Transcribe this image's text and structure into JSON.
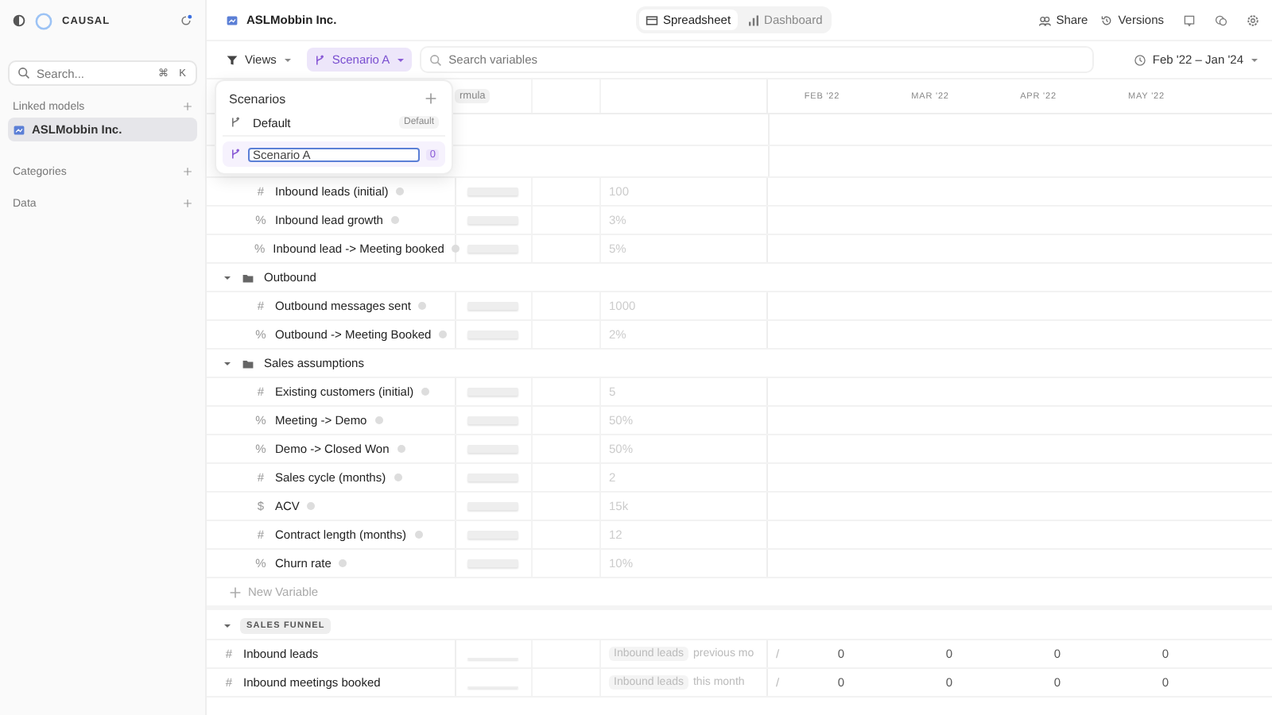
{
  "sidebar": {
    "brand": "CAUSAL",
    "search": {
      "placeholder": "Search...",
      "keys": [
        "⌘",
        "K"
      ]
    },
    "sections": [
      {
        "title": "Linked models",
        "items": [
          {
            "label": "ASLMobbin Inc.",
            "selected": true
          }
        ]
      },
      {
        "title": "Categories"
      },
      {
        "title": "Data"
      }
    ]
  },
  "topbar": {
    "model": "ASLMobbin Inc.",
    "views": [
      {
        "label": "Spreadsheet",
        "selected": true,
        "kind": "table"
      },
      {
        "label": "Dashboard",
        "selected": false,
        "kind": "chart"
      }
    ],
    "actions": [
      "Share",
      "Versions"
    ]
  },
  "toolbar": {
    "views": "Views",
    "scenario": "Scenario A",
    "search": {
      "placeholder": "Search variables"
    },
    "date_range": "Feb '22 – Jan '24"
  },
  "header": {
    "column_2": "rmula",
    "months": [
      "FEB '22",
      "MAR '22",
      "APR '22",
      "MAY '22"
    ]
  },
  "scenarios_menu": {
    "title": "Scenarios",
    "items": [
      {
        "kind": "item",
        "label": "Default",
        "badge": "Default"
      },
      {
        "kind": "editing",
        "value": "Scenario A",
        "count": "0"
      }
    ]
  },
  "rows": [
    {
      "kind": "variable",
      "icon": "#",
      "name": "Inbound leads (initial)",
      "value": "100"
    },
    {
      "kind": "variable",
      "icon": "%",
      "name": "Inbound lead growth",
      "value": "3%"
    },
    {
      "kind": "variable",
      "icon": "%",
      "name": "Inbound lead -> Meeting booked",
      "value": "5%"
    },
    {
      "kind": "group",
      "name": "Outbound",
      "expanded": true
    },
    {
      "kind": "variable",
      "icon": "#",
      "name": "Outbound messages sent",
      "value": "1000"
    },
    {
      "kind": "variable",
      "icon": "%",
      "name": "Outbound -> Meeting Booked",
      "value": "2%"
    },
    {
      "kind": "group",
      "name": "Sales assumptions",
      "expanded": true
    },
    {
      "kind": "variable",
      "icon": "#",
      "name": "Existing customers (initial)",
      "value": "5"
    },
    {
      "kind": "variable",
      "icon": "%",
      "name": "Meeting -> Demo",
      "value": "50%"
    },
    {
      "kind": "variable",
      "icon": "%",
      "name": "Demo -> Closed Won",
      "value": "50%"
    },
    {
      "kind": "variable",
      "icon": "#",
      "name": "Sales cycle (months)",
      "value": "2"
    },
    {
      "kind": "variable",
      "icon": "$",
      "name": "ACV",
      "value": "15k"
    },
    {
      "kind": "variable",
      "icon": "#",
      "name": "Contract length (months)",
      "value": "12"
    },
    {
      "kind": "variable",
      "icon": "%",
      "name": "Churn rate",
      "value": "10%"
    },
    {
      "kind": "new",
      "name": "New Variable"
    },
    {
      "kind": "section",
      "name": "SALES FUNNEL",
      "expanded": true
    },
    {
      "kind": "formula",
      "icon": "#",
      "name": "Inbound leads",
      "chip": "Inbound leads",
      "rest": "previous mo",
      "op": "/",
      "months": [
        "0",
        "0",
        "0",
        "0"
      ]
    },
    {
      "kind": "formula",
      "icon": "#",
      "name": "Inbound meetings booked",
      "chip": "Inbound leads",
      "rest": "this month",
      "op": "/",
      "months": [
        "0",
        "0",
        "0",
        "0"
      ]
    }
  ]
}
